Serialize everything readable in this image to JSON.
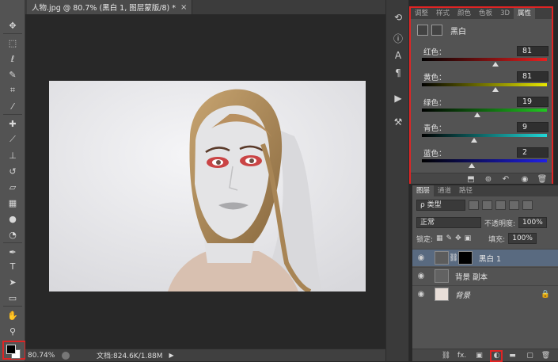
{
  "document": {
    "tab_title": "人物.jpg @ 80.7% (黑白 1, 图层蒙版/8) *",
    "close_glyph": "×"
  },
  "toolbar": {
    "tools": [
      "move-tool",
      "marquee-tool",
      "lasso-tool",
      "quick-select-tool",
      "crop-tool",
      "eyedropper-tool",
      "healing-brush-tool",
      "brush-tool",
      "clone-stamp-tool",
      "history-brush-tool",
      "eraser-tool",
      "gradient-tool",
      "blur-tool",
      "dodge-tool",
      "pen-tool",
      "type-tool",
      "path-select-tool",
      "shape-tool",
      "hand-tool",
      "zoom-tool"
    ],
    "type_glyph": "T"
  },
  "status": {
    "zoom": "80.74%",
    "doc_info": "文档:824.6K/1.88M",
    "arrow": "▶"
  },
  "properties": {
    "tabs": [
      "调整",
      "样式",
      "颜色",
      "色板",
      "3D",
      "属性"
    ],
    "active_tab": "属性",
    "title": "黑白",
    "sliders": [
      {
        "label": "红色：",
        "value": "81",
        "percent": 59,
        "gradient": "linear-gradient(90deg,#000,#e62020)"
      },
      {
        "label": "黄色：",
        "value": "81",
        "percent": 59,
        "gradient": "linear-gradient(90deg,#000,#e8e800)"
      },
      {
        "label": "绿色：",
        "value": "19",
        "percent": 44,
        "gradient": "linear-gradient(90deg,#000,#20c820)"
      },
      {
        "label": "青色：",
        "value": "9",
        "percent": 42,
        "gradient": "linear-gradient(90deg,#000,#20d8d8)"
      },
      {
        "label": "蓝色：",
        "value": "2",
        "percent": 40,
        "gradient": "linear-gradient(90deg,#000,#2020e6)"
      }
    ]
  },
  "layers": {
    "tabs": [
      "图层",
      "通道",
      "路径"
    ],
    "active_tab": "图层",
    "filter_kind": "ρ 类型",
    "blend_mode": "正常",
    "opacity_label": "不透明度:",
    "opacity_value": "100%",
    "lock_label": "锁定:",
    "fill_label": "填充:",
    "fill_value": "100%",
    "items": [
      {
        "name": "黑白 1",
        "selected": true
      },
      {
        "name": "背景 副本",
        "selected": false
      },
      {
        "name": "背景",
        "selected": false
      }
    ],
    "fx_label": "fx."
  },
  "colors": {
    "highlight": "#e02424",
    "selected_layer": "#596a80"
  }
}
